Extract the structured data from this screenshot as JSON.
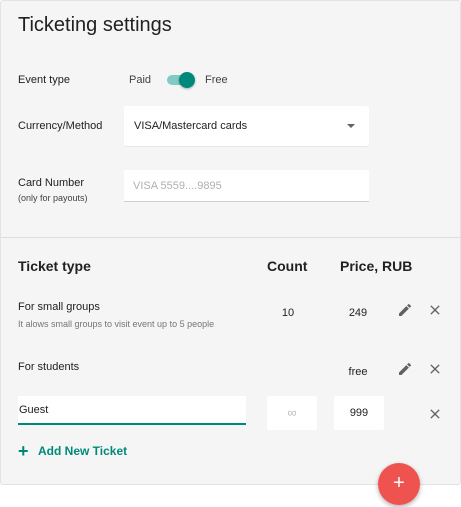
{
  "page": {
    "title": "Ticketing settings"
  },
  "event_type": {
    "label": "Event type",
    "option_paid": "Paid",
    "option_free": "Free",
    "selected": "Free"
  },
  "currency": {
    "label": "Currency/Method",
    "value": "VISA/Mastercard cards"
  },
  "card_number": {
    "label": "Card Number",
    "sublabel": "(only for payouts)",
    "placeholder": "VISA 5559....9895"
  },
  "table": {
    "headers": {
      "type": "Ticket type",
      "count": "Count",
      "price": "Price, RUB"
    },
    "rows": [
      {
        "name": "For small groups",
        "description": "It alows small groups to visit event up to 5 people",
        "count": "10",
        "price": "249"
      },
      {
        "name": "For students",
        "description": "",
        "count": "",
        "price": "free"
      }
    ],
    "new_row": {
      "name_value": "Guest",
      "count_value": "∞",
      "price_value": "999"
    }
  },
  "actions": {
    "add_ticket": "Add New Ticket",
    "fab_symbol": "+"
  },
  "colors": {
    "accent": "#00897b",
    "fab": "#ef5350",
    "card_bg": "#f5f5f5"
  },
  "icons": {
    "edit": "pencil-icon",
    "delete": "close-icon",
    "add": "plus-icon",
    "dropdown": "caret-down-icon"
  }
}
